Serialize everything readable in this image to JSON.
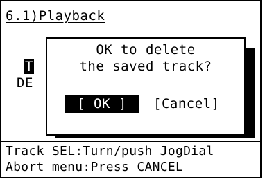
{
  "header": {
    "title": "6.1)Playback"
  },
  "background_menu": {
    "line1_highlight": "T",
    "line2": "DE"
  },
  "dialog": {
    "message_line1": "OK to delete",
    "message_line2": "the saved track?",
    "ok_label": "[ OK ]",
    "cancel_label": "[Cancel]"
  },
  "footer": {
    "line1": "Track SEL:Turn/push JogDial",
    "line2": "Abort menu:Press CANCEL"
  }
}
